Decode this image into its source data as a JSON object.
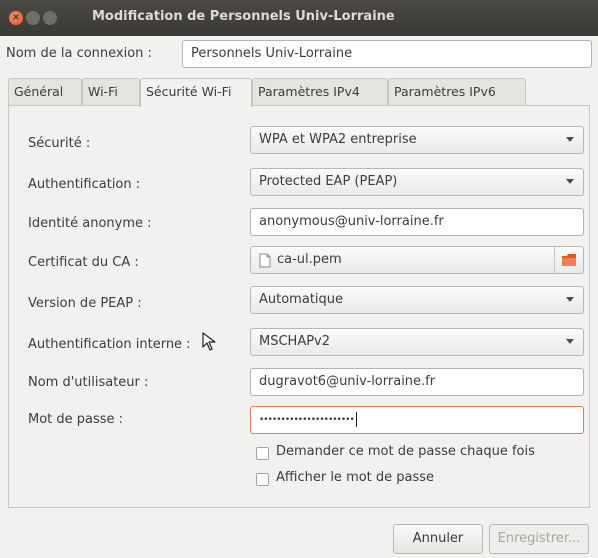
{
  "window": {
    "title": "Modification de Personnels Univ-Lorraine"
  },
  "connection": {
    "label": "Nom de la connexion :",
    "value": "Personnels Univ-Lorraine"
  },
  "tabs": [
    {
      "label": "Général"
    },
    {
      "label": "Wi-Fi"
    },
    {
      "label": "Sécurité Wi-Fi"
    },
    {
      "label": "Paramètres IPv4"
    },
    {
      "label": "Paramètres IPv6"
    }
  ],
  "form": {
    "security": {
      "label": "Sécurité :",
      "value": "WPA et WPA2 entreprise"
    },
    "auth": {
      "label": "Authentification :",
      "value": "Protected EAP (PEAP)"
    },
    "anon": {
      "label": "Identité anonyme :",
      "value": "anonymous@univ-lorraine.fr"
    },
    "cert": {
      "label": "Certificat du CA :",
      "value": "ca-ul.pem"
    },
    "peap": {
      "label": "Version de PEAP :",
      "value": "Automatique"
    },
    "inner": {
      "label": "Authentification interne :",
      "value": "MSCHAPv2"
    },
    "user": {
      "label": "Nom d'utilisateur :",
      "value": "dugravot6@univ-lorraine.fr"
    },
    "password": {
      "label": "Mot de passe :",
      "value": "••••••••••••••••••••••"
    },
    "ask_each_time": {
      "label": "Demander ce mot de passe chaque fois"
    },
    "show_password": {
      "label": "Afficher le mot de passe"
    }
  },
  "buttons": {
    "cancel": "Annuler",
    "save": "Enregistrer..."
  },
  "icons": {
    "close": "close-icon",
    "minimize": "minimize-icon",
    "maximize": "maximize-icon",
    "file": "file-icon",
    "folder": "folder-icon",
    "cursor": "mouse-cursor-icon"
  },
  "colors": {
    "titlebar": "#3c3b37",
    "close": "#e25424",
    "focus": "#e87b5a"
  }
}
